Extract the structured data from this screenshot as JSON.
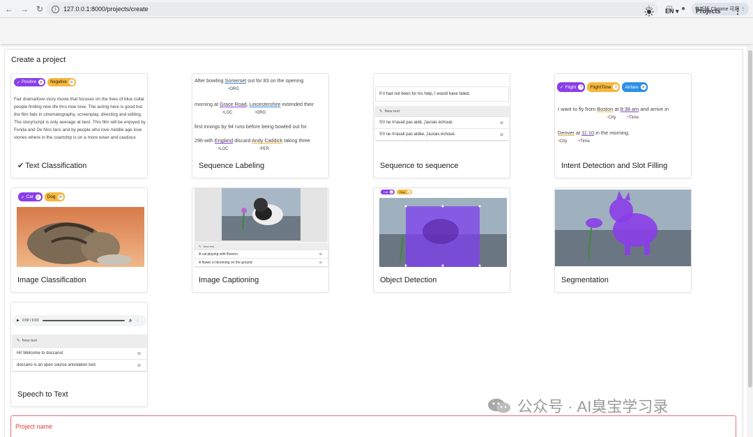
{
  "browser": {
    "url": "127.0.0.1:8000/projects/create",
    "profile_pill": "有新版 Chrome 可用 ⋮"
  },
  "header": {
    "language": "EN",
    "projects_label": "Projects"
  },
  "page": {
    "title": "Create a project",
    "project_name_label": "Project name"
  },
  "cards": [
    {
      "title": "Text Classification",
      "chips": [
        {
          "label": "Positive",
          "count": "p",
          "color": "#8a3ee8"
        },
        {
          "label": "Negative",
          "count": "n",
          "color": "#f6b73c"
        }
      ],
      "body": "Fair drama/love story movie that focuses on the lives of blue collar people finding new life thru new love. The acting here is good but the film fails in cinematography, screenplay, directing and editing. The story/script is only average at best. This film will be enjoyed by Fonda and De Niro fans and by people who love middle age love stories where in the coartship is on a more wiser and cautious"
    },
    {
      "title": "Sequence Labeling",
      "lines": [
        {
          "before": "After bowling ",
          "ent": "Somerset",
          "ent_tag": "ORG",
          "after": " out for 83 on the opening"
        },
        {
          "before": "morning at ",
          "ent": "Grace Road",
          "ent_tag": "LOC",
          "mid": ", ",
          "ent2": "Leicestershire",
          "ent2_tag": "ORG",
          "after": " extended their"
        },
        {
          "text": "first innings by 94 runs before being bowled out for"
        },
        {
          "before": "296 with ",
          "ent": "England",
          "ent_tag": "LOC",
          "mid": " discard ",
          "ent2": "Andy Caddick",
          "ent2_tag": "PER",
          "after": " taking three"
        }
      ]
    },
    {
      "title": "Sequence to sequence",
      "source": "If it had not been for his help, I would have failed.",
      "new_text": "New text",
      "rows": [
        "S'il ne m'avait pas aidé, j'aurais échoué.",
        "S'il ne m'avait pas aidée, j'aurais échoué."
      ]
    },
    {
      "title": "Intent Detection and Slot Filling",
      "chips": [
        {
          "label": "Flight",
          "count": "f",
          "color": "#8a3ee8"
        },
        {
          "label": "FlightTime",
          "count": "t",
          "color": "#f6b73c"
        },
        {
          "label": "Airfare",
          "count": "a",
          "color": "#2d8fe8"
        }
      ],
      "line1": {
        "before": "I want to fly from ",
        "ent": "Boston",
        "ent_tag": "City",
        "mid": " at ",
        "ent2": "8:38 am",
        "ent2_tag": "Time",
        "after": " and arrive in"
      },
      "line2": {
        "ent": "Denver",
        "ent_tag": "City",
        "mid": " at ",
        "ent2": "11:10",
        "ent2_tag": "Time",
        "after": " in the morning."
      }
    },
    {
      "title": "Image Classification",
      "chips": [
        {
          "label": "Cat",
          "count": "c",
          "color": "#8a3ee8"
        },
        {
          "label": "Dog",
          "count": "d",
          "color": "#f6b73c"
        }
      ]
    },
    {
      "title": "Image Captioning",
      "new_text": "New text",
      "rows": [
        "A cat playing with flowers",
        "A flower is blooming on the ground"
      ]
    },
    {
      "title": "Object Detection",
      "chips": [
        {
          "label": "Cat",
          "count": "c",
          "color": "#8a3ee8"
        },
        {
          "label": "Dog",
          "count": "d",
          "color": "#f6b73c"
        }
      ]
    },
    {
      "title": "Segmentation"
    },
    {
      "title": "Speech to Text",
      "audio_time": "0:00 / 0:03",
      "new_text": "New text",
      "rows": [
        "Hi! Welcome to doccano!",
        "doccano is an open source annotation tool."
      ]
    }
  ],
  "watermark": "公众号 · AI臭宝学习录",
  "colors": {
    "purple": "#8a3ee8",
    "orange": "#f6b73c",
    "blue": "#2d8fe8",
    "error_red": "#e53935"
  }
}
